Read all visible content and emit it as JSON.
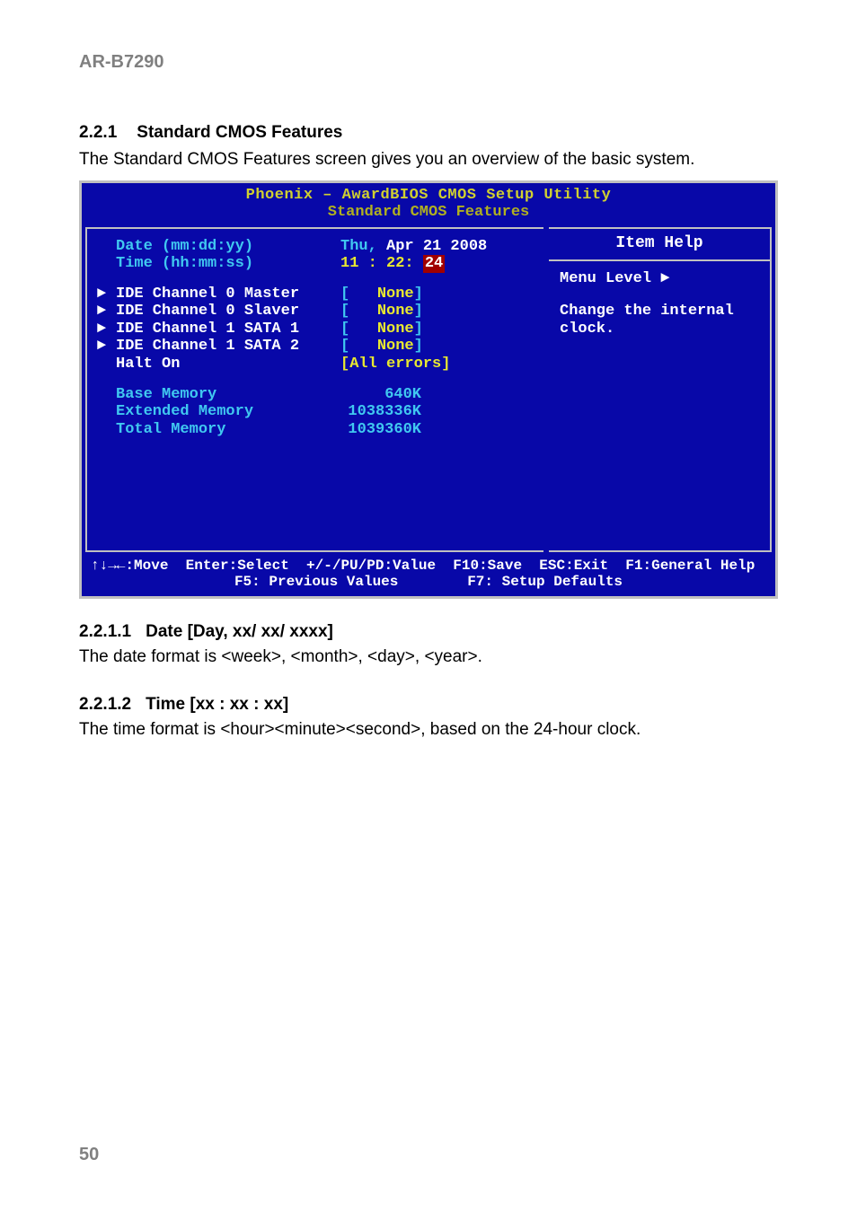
{
  "header": "AR-B7290",
  "section": {
    "number": "2.2.1",
    "title": "Standard CMOS Features",
    "intro": "The Standard CMOS Features screen gives you an overview of the basic system."
  },
  "bios": {
    "title": "Phoenix – AwardBIOS CMOS Setup Utility",
    "subtitle": "Standard CMOS Features",
    "date": {
      "label": "Date (mm:dd:yy)",
      "day": "Thu,",
      "value": "Apr 21 2008"
    },
    "time": {
      "label": "Time (hh:mm:ss)",
      "hh": "11",
      "mm": "22",
      "ss": "24"
    },
    "channels": [
      {
        "label": "IDE Channel 0 Master",
        "value": "None"
      },
      {
        "label": "IDE Channel 0 Slaver",
        "value": "None"
      },
      {
        "label": "IDE Channel 1 SATA 1",
        "value": "None"
      },
      {
        "label": "IDE Channel 1 SATA 2",
        "value": "None"
      }
    ],
    "halt": {
      "label": "Halt On",
      "value": "[All errors]"
    },
    "memory": {
      "base": {
        "label": "Base Memory",
        "value": "640K"
      },
      "extended": {
        "label": "Extended Memory",
        "value": "1038336K"
      },
      "total": {
        "label": "Total Memory",
        "value": "1039360K"
      }
    },
    "help": {
      "title": "Item Help",
      "menu_level": "Menu Level",
      "desc": "Change the internal clock."
    },
    "footer": {
      "line1": "↑↓→←:Move  Enter:Select  +/-/PU/PD:Value  F10:Save  ESC:Exit  F1:General Help",
      "line2": "F5: Previous Values        F7: Setup Defaults"
    }
  },
  "sub1": {
    "number": "2.2.1.1",
    "title": "Date [Day, xx/ xx/ xxxx]",
    "text": "The date format is <week>, <month>, <day>, <year>."
  },
  "sub2": {
    "number": "2.2.1.2",
    "title": "Time [xx : xx : xx]",
    "text": "The time format is <hour><minute><second>, based on the 24-hour clock."
  },
  "page_number": "50"
}
